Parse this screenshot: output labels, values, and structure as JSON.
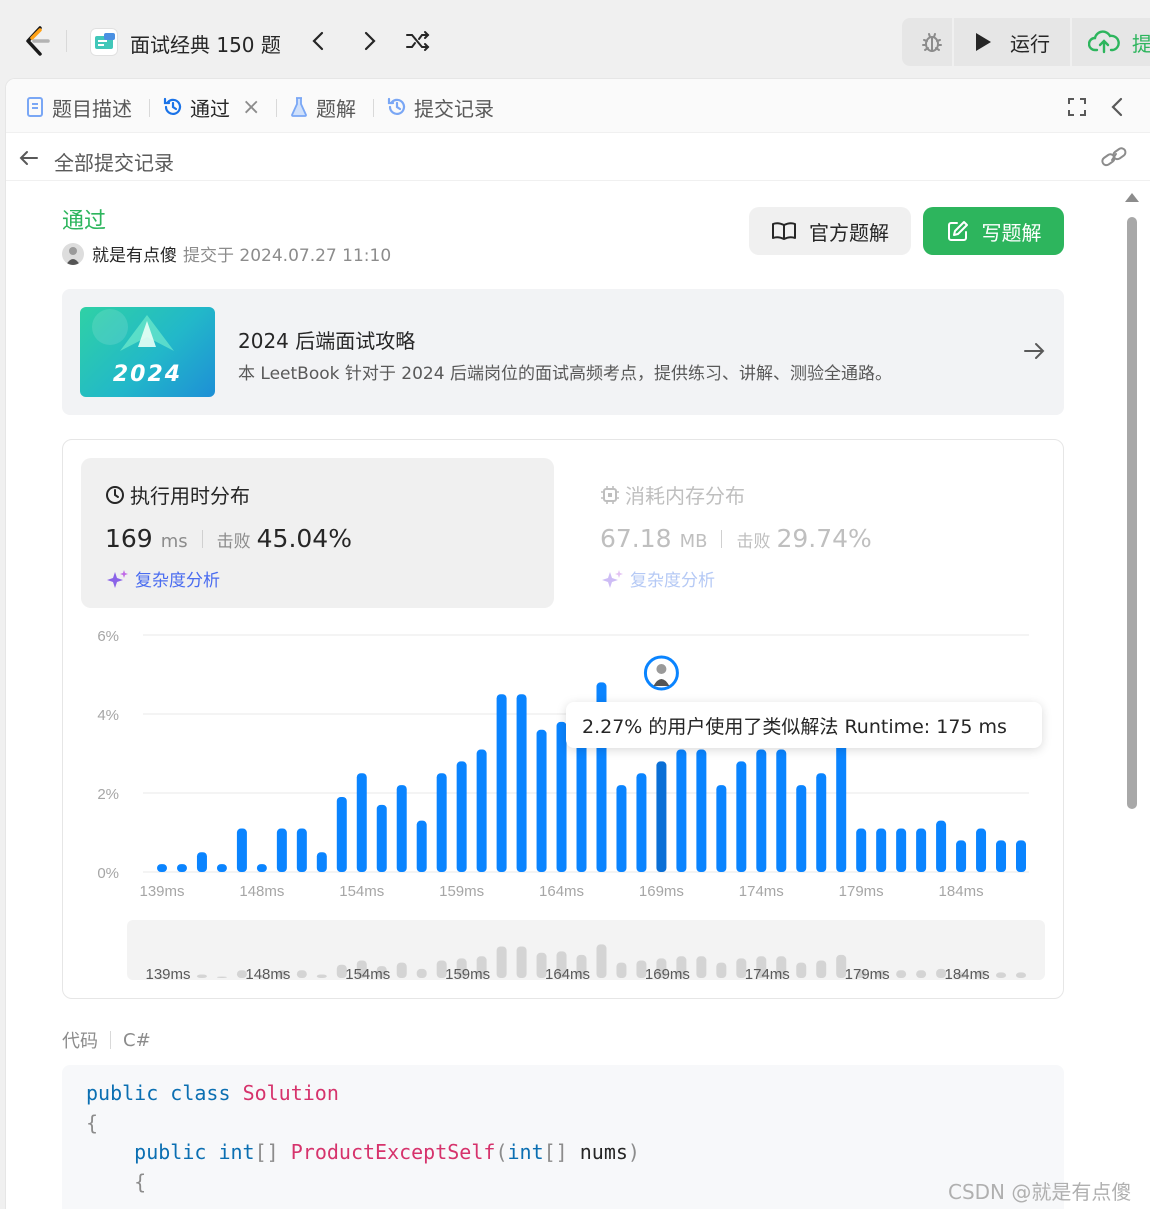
{
  "topbar": {
    "problem_list_title": "面试经典 150 题",
    "run_label": "运行",
    "submit_label": "提"
  },
  "tabs": [
    {
      "label": "题目描述",
      "icon": "description-icon"
    },
    {
      "label": "通过",
      "icon": "history-icon"
    },
    {
      "label": "题解",
      "icon": "flask-icon"
    },
    {
      "label": "提交记录",
      "icon": "history-icon"
    }
  ],
  "back_row": {
    "label": "全部提交记录"
  },
  "submission": {
    "status": "通过",
    "user": "就是有点傻",
    "submitted_at": "提交于 2024.07.27 11:10",
    "official_solution_label": "官方题解",
    "write_solution_label": "写题解"
  },
  "leetbook": {
    "cover_text": "2024",
    "title": "2024 后端面试攻略",
    "description": "本 LeetBook 针对于 2024 后端岗位的面试高频考点，提供练习、讲解、测验全通路。"
  },
  "runtime": {
    "title": "执行用时分布",
    "value": "169",
    "unit": "ms",
    "beat_label": "击败",
    "beat_value": "45.04%",
    "complexity_label": "复杂度分析"
  },
  "memory": {
    "title": "消耗内存分布",
    "value": "67.18",
    "unit": "MB",
    "beat_label": "击败",
    "beat_value": "29.74%",
    "complexity_label": "复杂度分析"
  },
  "tooltip": {
    "text": "2.27% 的用户使用了类似解法 Runtime: 175 ms"
  },
  "chart_data": {
    "type": "bar",
    "ylabel": "",
    "xlabel": "",
    "ylim": [
      0,
      6
    ],
    "y_ticks": [
      "0%",
      "2%",
      "4%",
      "6%"
    ],
    "x_ticks": [
      "139ms",
      "148ms",
      "154ms",
      "159ms",
      "164ms",
      "169ms",
      "174ms",
      "179ms",
      "184ms"
    ],
    "values": [
      0.2,
      0.2,
      0.5,
      0.2,
      1.1,
      0.2,
      1.1,
      1.1,
      0.5,
      1.9,
      2.5,
      1.7,
      2.2,
      1.3,
      2.5,
      2.8,
      3.1,
      4.5,
      4.5,
      3.6,
      3.8,
      3.3,
      4.8,
      2.2,
      2.5,
      2.8,
      3.1,
      3.1,
      2.2,
      2.8,
      3.1,
      3.1,
      2.2,
      2.5,
      3.3,
      1.1,
      1.1,
      1.1,
      1.1,
      1.3,
      0.8,
      1.1,
      0.8,
      0.8
    ],
    "bar_color": "#0a84ff",
    "highlight_color": "#0a6fd6",
    "current_bar_index": 25,
    "grid": true
  },
  "code": {
    "header_label": "代码",
    "language": "C#"
  },
  "watermark": "CSDN @就是有点傻"
}
